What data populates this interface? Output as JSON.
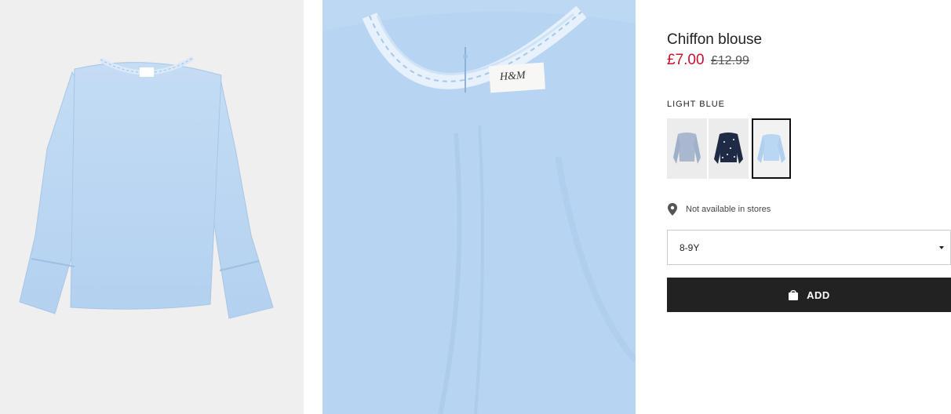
{
  "product": {
    "title": "Chiffon blouse",
    "price_current": "£7.00",
    "price_original": "£12.99"
  },
  "color": {
    "label": "LIGHT BLUE",
    "swatches": [
      {
        "name": "grey-blue blouse",
        "color": "#a9b8cf"
      },
      {
        "name": "navy floral blouse",
        "color": "#1f2a44"
      },
      {
        "name": "light blue blouse",
        "color": "#b9d6f2"
      }
    ],
    "selected_index": 2
  },
  "store": {
    "icon": "location-pin-icon",
    "text": "Not available in stores"
  },
  "size": {
    "selected": "8-9Y",
    "icon": "chevron-down-icon"
  },
  "add_button": {
    "label": "ADD",
    "icon": "shopping-bag-icon"
  },
  "images": {
    "main_tag_text": "H&M",
    "accent_color": "#b9d6f2"
  }
}
